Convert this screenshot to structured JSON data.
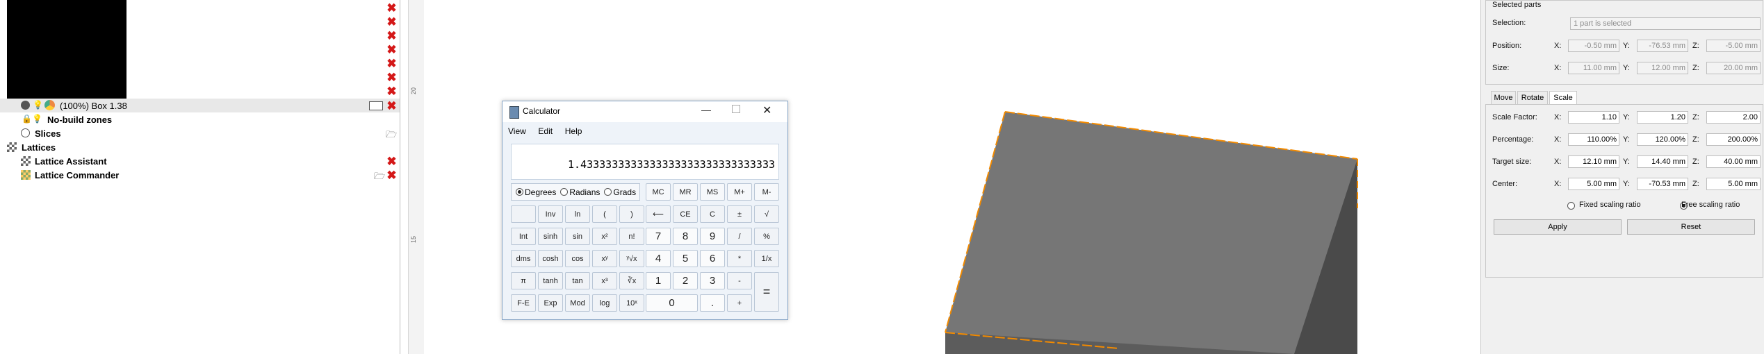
{
  "tree": {
    "items": [
      {
        "label": "(100%) Box 1.38",
        "selected": true
      },
      {
        "label": "No-build zones"
      },
      {
        "label": "Slices"
      },
      {
        "label": "Lattices"
      },
      {
        "label": "Lattice Assistant"
      },
      {
        "label": "Lattice Commander"
      }
    ]
  },
  "ruler": {
    "tick1": "20",
    "tick2": "15"
  },
  "calculator": {
    "title": "Calculator",
    "menu": [
      "View",
      "Edit",
      "Help"
    ],
    "display": "1.4333333333333333333333333333333",
    "angle_modes": [
      "Degrees",
      "Radians",
      "Grads"
    ],
    "selected_mode": "Degrees",
    "memory": [
      "MC",
      "MR",
      "MS",
      "M+",
      "M-"
    ],
    "rows": [
      [
        "",
        "Inv",
        "ln",
        "(",
        ")",
        "⟵",
        "CE",
        "C",
        "±",
        "√"
      ],
      [
        "Int",
        "sinh",
        "sin",
        "x²",
        "n!",
        "7",
        "8",
        "9",
        "/",
        "%"
      ],
      [
        "dms",
        "cosh",
        "cos",
        "xʸ",
        "ʸ√x",
        "4",
        "5",
        "6",
        "*",
        "1/x"
      ],
      [
        "π",
        "tanh",
        "tan",
        "x³",
        "∛x",
        "1",
        "2",
        "3",
        "-",
        "="
      ],
      [
        "F-E",
        "Exp",
        "Mod",
        "log",
        "10ˣ",
        "0",
        ".",
        "+"
      ]
    ]
  },
  "right": {
    "section_title": "Selected parts",
    "selection_label": "Selection:",
    "selection_value": "1 part is selected",
    "position_label": "Position:",
    "size_label": "Size:",
    "x": "X:",
    "y": "Y:",
    "z": "Z:",
    "position": [
      "-0.50 mm",
      "-76.53 mm",
      "-5.00 mm"
    ],
    "size": [
      "11.00 mm",
      "12.00 mm",
      "20.00 mm"
    ],
    "tabs": [
      "Move",
      "Rotate",
      "Scale"
    ],
    "active_tab": "Scale",
    "scale_factor_label": "Scale Factor:",
    "percentage_label": "Percentage:",
    "target_size_label": "Target size:",
    "center_label": "Center:",
    "scale_factor": [
      "1.10",
      "1.20",
      "2.00"
    ],
    "percentage": [
      "110.00%",
      "120.00%",
      "200.00%"
    ],
    "target_size": [
      "12.10 mm",
      "14.40 mm",
      "40.00 mm"
    ],
    "center": [
      "5.00 mm",
      "-70.53 mm",
      "5.00 mm"
    ],
    "fixed_ratio": "Fixed scaling ratio",
    "free_ratio": "Free scaling ratio",
    "apply": "Apply",
    "reset": "Reset"
  },
  "colors": {
    "accent": "#f28a00",
    "box_top": "#767676",
    "box_side": "#4a4a4a",
    "delete": "#d41818"
  }
}
